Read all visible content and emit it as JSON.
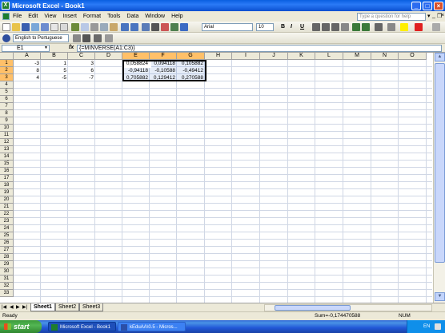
{
  "window": {
    "title": "Microsoft Excel - Book1",
    "icon_letter": "X"
  },
  "menu": {
    "items": [
      "File",
      "Edit",
      "View",
      "Insert",
      "Format",
      "Tools",
      "Data",
      "Window",
      "Help"
    ],
    "help_placeholder": "Type a question for help",
    "dropdown_glyph": "▾",
    "mdi_minimize": "_",
    "mdi_restore": "❐",
    "mdi_close": "×"
  },
  "toolbar": {
    "font_name": "Arial",
    "font_size": "10",
    "bold": "B",
    "italic": "I",
    "underline": "U",
    "translate_label": "English to Portuguese"
  },
  "formula_bar": {
    "name_box": "E1",
    "fx": "fx",
    "formula": "{=MINVERSE(A1:C3)}"
  },
  "columns": [
    "A",
    "B",
    "C",
    "D",
    "E",
    "F",
    "G",
    "H",
    "I",
    "J",
    "K",
    "L",
    "M",
    "N",
    "O"
  ],
  "selected_columns": [
    "E",
    "F",
    "G"
  ],
  "row_count": 33,
  "selected_rows": [
    1,
    2,
    3
  ],
  "cells": {
    "A1": "-3",
    "B1": "1",
    "C1": "3",
    "A2": "8",
    "B2": "5",
    "C2": "6",
    "A3": "4",
    "B3": "-5",
    "C3": "-7",
    "E1": "0,058824",
    "F1": "0,094118",
    "G1": "0,105882",
    "E2": "-0,94118",
    "F2": "-0,10588",
    "G2": "-0,49412",
    "E3": "0,705882",
    "F3": "0,129412",
    "G3": "0,270588"
  },
  "sheets": [
    "Sheet1",
    "Sheet2",
    "Sheet3"
  ],
  "active_sheet": "Sheet1",
  "status": {
    "ready": "Ready",
    "sum": "Sum=-0,174470588",
    "num": "NUM"
  },
  "taskbar": {
    "start": "start",
    "tasks": [
      "Microsoft Excel - Book1",
      "kEduAA\\0.5 - Micros..."
    ],
    "tray_lang": "EN",
    "tray_time": "..."
  },
  "colors": {
    "selection_header": "#ffc069",
    "title_blue": "#0a5fe0",
    "start_green": "#3c9c3c"
  }
}
